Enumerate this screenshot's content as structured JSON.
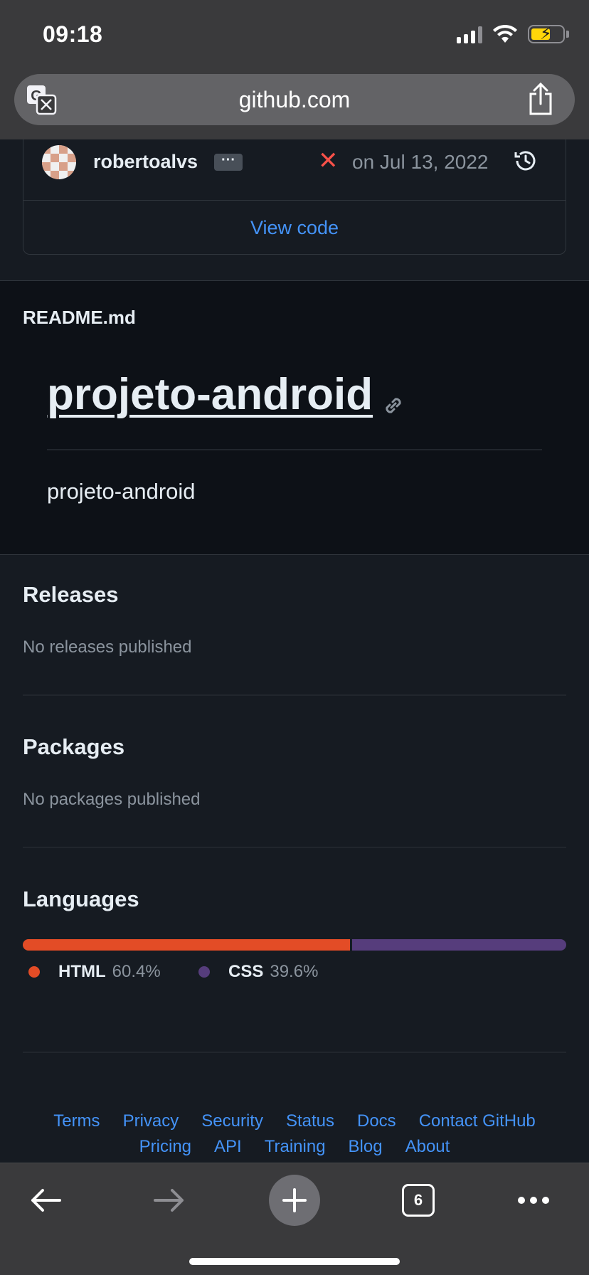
{
  "status_bar": {
    "time": "09:18"
  },
  "browser": {
    "url": "github.com"
  },
  "commit": {
    "author": "robertoalvs",
    "more_label": "···",
    "status_icon": "x-mark",
    "date": "on Jul 13, 2022",
    "view_code_label": "View code"
  },
  "readme": {
    "filename": "README.md",
    "heading": "projeto-android",
    "body": "projeto-android"
  },
  "releases": {
    "title": "Releases",
    "empty_text": "No releases published"
  },
  "packages": {
    "title": "Packages",
    "empty_text": "No packages published"
  },
  "languages": {
    "title": "Languages",
    "items": [
      {
        "name": "HTML",
        "percent": "60.4%",
        "share": 60.4,
        "color": "#e34c26"
      },
      {
        "name": "CSS",
        "percent": "39.6%",
        "share": 39.6,
        "color": "#563d7c"
      }
    ]
  },
  "footer": {
    "row1": [
      "Terms",
      "Privacy",
      "Security",
      "Status",
      "Docs",
      "Contact GitHub"
    ],
    "row2": [
      "Pricing",
      "API",
      "Training",
      "Blog",
      "About"
    ]
  },
  "toolbar": {
    "tab_count": "6"
  },
  "colors": {
    "link": "#4493f8",
    "muted": "#8b949e",
    "page_bg": "#161b22"
  }
}
